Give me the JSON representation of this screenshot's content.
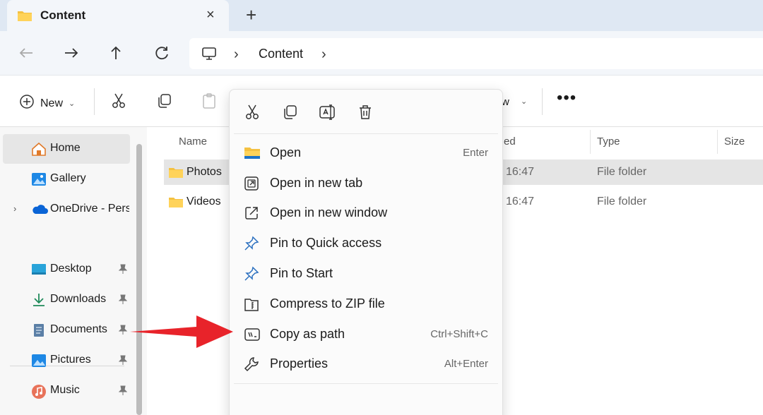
{
  "tab": {
    "title": "Content",
    "close": "×",
    "new_tab": "+"
  },
  "address": {
    "crumbs": [
      "Content"
    ],
    "sep": "›"
  },
  "toolbar": {
    "new_label": "New",
    "chev": "⌄",
    "view_partial": "w",
    "more": "•••"
  },
  "sidebar": {
    "items": [
      {
        "label": "Home",
        "icon": "home-icon"
      },
      {
        "label": "Gallery",
        "icon": "gallery-icon"
      },
      {
        "label": "OneDrive - Perso",
        "icon": "onedrive-icon",
        "expand": "›"
      },
      {
        "label": "Desktop",
        "icon": "desktop-icon",
        "pin": "📌"
      },
      {
        "label": "Downloads",
        "icon": "downloads-icon",
        "pin": "📌"
      },
      {
        "label": "Documents",
        "icon": "documents-icon",
        "pin": "📌"
      },
      {
        "label": "Pictures",
        "icon": "pictures-icon",
        "pin": "📌"
      },
      {
        "label": "Music",
        "icon": "music-icon",
        "pin": "📌"
      }
    ]
  },
  "files": {
    "columns": {
      "name": "Name",
      "modified_partial": "ed",
      "type": "Type",
      "size": "Size"
    },
    "rows": [
      {
        "name": "Photos",
        "date": "16:47",
        "type": "File folder"
      },
      {
        "name": "Videos",
        "date": "16:47",
        "type": "File folder"
      }
    ]
  },
  "context_menu": {
    "items": [
      {
        "label": "Open",
        "shortcut": "Enter",
        "icon": "folder-open-icon"
      },
      {
        "label": "Open in new tab",
        "shortcut": "",
        "icon": "new-tab-icon"
      },
      {
        "label": "Open in new window",
        "shortcut": "",
        "icon": "new-window-icon"
      },
      {
        "label": "Pin to Quick access",
        "shortcut": "",
        "icon": "pin-icon"
      },
      {
        "label": "Pin to Start",
        "shortcut": "",
        "icon": "pin-start-icon"
      },
      {
        "label": "Compress to ZIP file",
        "shortcut": "",
        "icon": "zip-icon"
      },
      {
        "label": "Copy as path",
        "shortcut": "Ctrl+Shift+C",
        "icon": "copy-path-icon"
      },
      {
        "label": "Properties",
        "shortcut": "Alt+Enter",
        "icon": "properties-icon"
      }
    ]
  },
  "colors": {
    "accent": "#0067c0",
    "folder": "#f4c142",
    "arrow": "#e8232a",
    "selection": "#e5e5e5"
  }
}
